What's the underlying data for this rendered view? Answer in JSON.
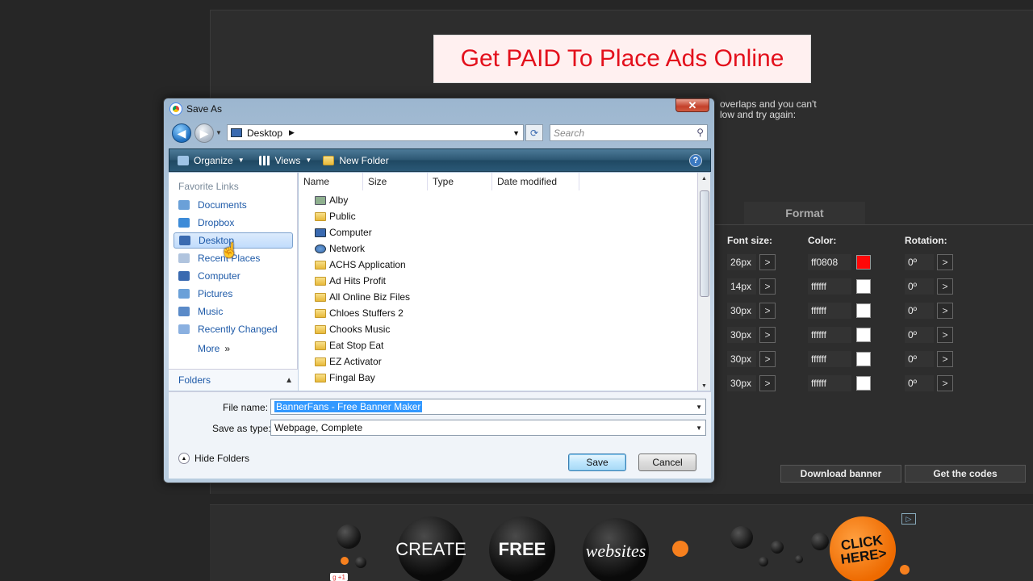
{
  "background": {
    "banner_text": "Get PAID To Place Ads Online",
    "help_text_line1": "overlaps and you can't",
    "help_text_line2": "low and try again:",
    "format_tab": "Format",
    "headers": {
      "font_size": "Font size:",
      "color": "Color:",
      "rotation": "Rotation:"
    },
    "rows": [
      {
        "font_size": "26px",
        "color": "ff0808",
        "swatch": "#ff0808",
        "rotation": "0º"
      },
      {
        "font_size": "14px",
        "color": "ffffff",
        "swatch": "#ffffff",
        "rotation": "0º"
      },
      {
        "font_size": "30px",
        "color": "ffffff",
        "swatch": "#ffffff",
        "rotation": "0º"
      },
      {
        "font_size": "30px",
        "color": "ffffff",
        "swatch": "#ffffff",
        "rotation": "0º"
      },
      {
        "font_size": "30px",
        "color": "ffffff",
        "swatch": "#ffffff",
        "rotation": "0º"
      },
      {
        "font_size": "30px",
        "color": "ffffff",
        "swatch": "#ffffff",
        "rotation": "0º"
      }
    ],
    "arrow_label": ">",
    "download_banner": "Download banner",
    "get_codes": "Get the codes",
    "ad": {
      "create": "CREATE",
      "free": "FREE",
      "websites": "websites",
      "click_here": "CLICK HERE>",
      "gplus": "g +1"
    }
  },
  "dialog": {
    "title": "Save As",
    "close_label": "✕",
    "address": "Desktop",
    "search_placeholder": "Search",
    "toolbar": {
      "organize": "Organize",
      "views": "Views",
      "new_folder": "New Folder",
      "help": "?"
    },
    "favorite_links_label": "Favorite Links",
    "favorite_links": [
      "Documents",
      "Dropbox",
      "Desktop",
      "Recent Places",
      "Computer",
      "Pictures",
      "Music",
      "Recently Changed"
    ],
    "more": "More",
    "more_chevron": "»",
    "folders_label": "Folders",
    "columns": [
      "Name",
      "Size",
      "Type",
      "Date modified"
    ],
    "files": [
      "Alby",
      "Public",
      "Computer",
      "Network",
      "ACHS Application",
      "Ad Hits Profit",
      "All Online Biz Files",
      "Chloes Stuffers 2",
      "Chooks Music",
      "Eat Stop Eat",
      "EZ Activator",
      "Fingal Bay"
    ],
    "file_name_label": "File name:",
    "file_name_value": "BannerFans - Free Banner Maker",
    "save_as_type_label": "Save as type:",
    "save_as_type_value": "Webpage, Complete",
    "hide_folders": "Hide Folders",
    "save_button": "Save",
    "cancel_button": "Cancel"
  }
}
